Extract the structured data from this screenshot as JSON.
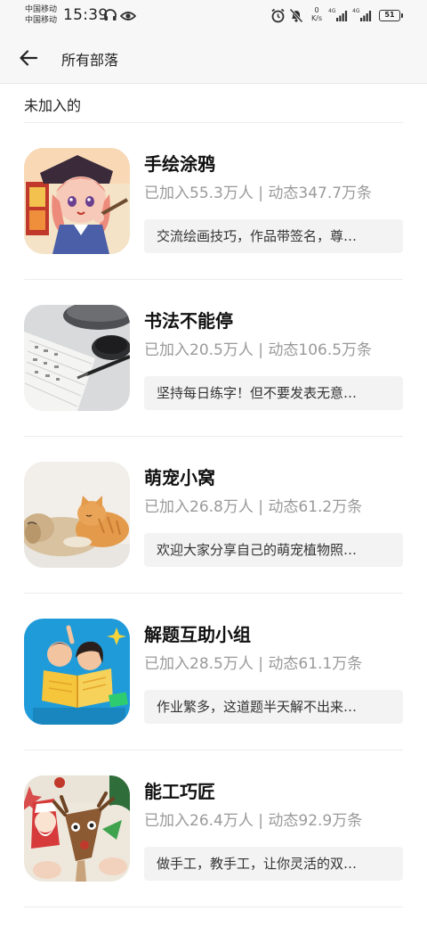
{
  "status_bar": {
    "carrier_1": "中国移动",
    "carrier_2": "中国移动",
    "time": "15:39",
    "speed_value": "0",
    "speed_unit": "K/s",
    "network_1": "4G",
    "network_2": "4G",
    "battery": "51"
  },
  "header": {
    "title": "所有部落"
  },
  "section": {
    "title": "未加入的"
  },
  "tribes": [
    {
      "name": "手绘涂鸦",
      "stats": "已加入55.3万人 | 动态347.7万条",
      "description": "交流绘画技巧，作品带签名，尊…"
    },
    {
      "name": "书法不能停",
      "stats": "已加入20.5万人 | 动态106.5万条",
      "description": "坚持每日练字！但不要发表无意…"
    },
    {
      "name": "萌宠小窝",
      "stats": "已加入26.8万人 | 动态61.2万条",
      "description": "欢迎大家分享自己的萌宠植物照…"
    },
    {
      "name": "解题互助小组",
      "stats": "已加入28.5万人 | 动态61.1万条",
      "description": "作业繁多，这道题半天解不出来…"
    },
    {
      "name": "能工巧匠",
      "stats": "已加入26.4万人 | 动态92.9万条",
      "description": "做手工，教手工，让你灵活的双…"
    }
  ],
  "icons": {
    "back": "arrow-left-icon",
    "headphones": "headphones-icon",
    "eye": "eye-icon",
    "alarm": "alarm-icon",
    "mute": "bell-off-icon"
  },
  "colors": {
    "background": "#ffffff",
    "header_bg": "#f7f7f7",
    "stats_text": "#9a9a9a",
    "desc_bg": "#f3f3f3"
  }
}
